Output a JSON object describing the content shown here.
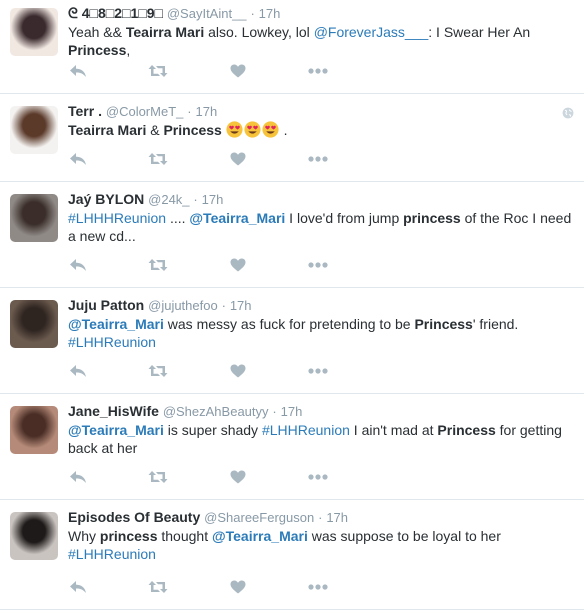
{
  "tweets": [
    {
      "fullname": "ᘓ 4□8□2□1□9□",
      "username": "@SayItAint__",
      "sep": "·",
      "time": "17h",
      "text": [
        {
          "t": "Yeah && "
        },
        {
          "t": "Teairra Mari",
          "b": true
        },
        {
          "t": " also. Lowkey, lol "
        },
        {
          "t": "@ForeverJass___",
          "link": true
        },
        {
          "t": ": I Swear Her An "
        },
        {
          "t": "Princess",
          "b": true
        },
        {
          "t": ","
        }
      ],
      "avatar_colors": [
        "#f2e8e2",
        "#3a2a2e"
      ]
    },
    {
      "fullname": "Terr .",
      "username": "@ColorMeT_",
      "sep": "·",
      "time": "17h",
      "text": [
        {
          "t": "Teairra Mari",
          "b": true
        },
        {
          "t": " & "
        },
        {
          "t": "Princess",
          "b": true
        },
        {
          "t": " "
        },
        {
          "emoji": "heart-eyes"
        },
        {
          "emoji": "heart-eyes"
        },
        {
          "emoji": "heart-eyes"
        },
        {
          "t": " ."
        }
      ],
      "avatar_colors": [
        "#f4f2f0",
        "#5b3a2a"
      ],
      "globe": true
    },
    {
      "fullname": "Jaý BYLON",
      "username": "@24k_",
      "sep": "·",
      "time": "17h",
      "text": [
        {
          "t": "#LHHHReunion",
          "link": true
        },
        {
          "t": " .... "
        },
        {
          "t": "@Teairra_Mari",
          "link": true,
          "b": true
        },
        {
          "t": " I love'd from jump "
        },
        {
          "t": "princess",
          "b": true
        },
        {
          "t": " of the Roc I need a new cd..."
        }
      ],
      "avatar_colors": [
        "#8f8a86",
        "#3b2e2a"
      ]
    },
    {
      "fullname": "Juju Patton",
      "username": "@jujuthefoo",
      "sep": "·",
      "time": "17h",
      "text": [
        {
          "t": "@Teairra_Mari",
          "link": true,
          "b": true
        },
        {
          "t": " was messy as fuck for pretending to be "
        },
        {
          "t": "Princess",
          "b": true
        },
        {
          "t": "' friend. "
        },
        {
          "t": "#LHHReunion",
          "link": true
        }
      ],
      "avatar_colors": [
        "#6b5a4e",
        "#2e2420"
      ]
    },
    {
      "fullname": "Jane_HisWife",
      "username": "@ShezAhBeautyy",
      "sep": "·",
      "time": "17h",
      "text": [
        {
          "t": "@Teairra_Mari",
          "link": true,
          "b": true
        },
        {
          "t": " is super shady "
        },
        {
          "t": "#LHHReunion",
          "link": true
        },
        {
          "t": " I ain't mad at "
        },
        {
          "t": "Princess",
          "b": true
        },
        {
          "t": " for getting back at her"
        }
      ],
      "avatar_colors": [
        "#b58a78",
        "#4a2e26"
      ]
    },
    {
      "fullname": "Episodes Of Beauty",
      "username": "@ShareeFerguson",
      "sep": "·",
      "time": "17h",
      "text": [
        {
          "t": "Why "
        },
        {
          "t": "princess",
          "b": true
        },
        {
          "t": " thought "
        },
        {
          "t": "@Teairra_Mari",
          "link": true,
          "b": true
        },
        {
          "t": " was suppose to be loyal to her "
        },
        {
          "t": "#LHHReunion",
          "link": true
        }
      ],
      "avatar_colors": [
        "#c9c4c0",
        "#1e1a19"
      ]
    }
  ],
  "tweet_heights": [
    98,
    88,
    106,
    106,
    106,
    110
  ],
  "colors": {
    "link": "#2b7bb9",
    "meta": "#8899a6",
    "action": "#aab8c2",
    "border": "#e1e8ed"
  },
  "action_icons": [
    "reply-icon",
    "retweet-icon",
    "favorite-icon",
    "more-icon"
  ]
}
